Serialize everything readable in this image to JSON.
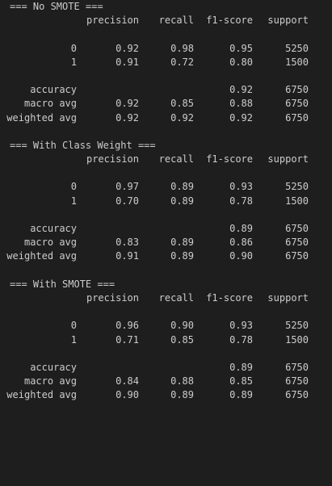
{
  "headers": {
    "precision": "precision",
    "recall": "recall",
    "f1": "f1-score",
    "support": "support"
  },
  "reports": [
    {
      "title": "=== No SMOTE ===",
      "classes": [
        {
          "label": "0",
          "precision": "0.92",
          "recall": "0.98",
          "f1": "0.95",
          "support": "5250"
        },
        {
          "label": "1",
          "precision": "0.91",
          "recall": "0.72",
          "f1": "0.80",
          "support": "1500"
        }
      ],
      "accuracy": {
        "label": "accuracy",
        "f1": "0.92",
        "support": "6750"
      },
      "macro": {
        "label": "macro avg",
        "precision": "0.92",
        "recall": "0.85",
        "f1": "0.88",
        "support": "6750"
      },
      "weighted": {
        "label": "weighted avg",
        "precision": "0.92",
        "recall": "0.92",
        "f1": "0.92",
        "support": "6750"
      }
    },
    {
      "title": "=== With Class Weight ===",
      "classes": [
        {
          "label": "0",
          "precision": "0.97",
          "recall": "0.89",
          "f1": "0.93",
          "support": "5250"
        },
        {
          "label": "1",
          "precision": "0.70",
          "recall": "0.89",
          "f1": "0.78",
          "support": "1500"
        }
      ],
      "accuracy": {
        "label": "accuracy",
        "f1": "0.89",
        "support": "6750"
      },
      "macro": {
        "label": "macro avg",
        "precision": "0.83",
        "recall": "0.89",
        "f1": "0.86",
        "support": "6750"
      },
      "weighted": {
        "label": "weighted avg",
        "precision": "0.91",
        "recall": "0.89",
        "f1": "0.90",
        "support": "6750"
      }
    },
    {
      "title": "=== With SMOTE ===",
      "classes": [
        {
          "label": "0",
          "precision": "0.96",
          "recall": "0.90",
          "f1": "0.93",
          "support": "5250"
        },
        {
          "label": "1",
          "precision": "0.71",
          "recall": "0.85",
          "f1": "0.78",
          "support": "1500"
        }
      ],
      "accuracy": {
        "label": "accuracy",
        "f1": "0.89",
        "support": "6750"
      },
      "macro": {
        "label": "macro avg",
        "precision": "0.84",
        "recall": "0.88",
        "f1": "0.85",
        "support": "6750"
      },
      "weighted": {
        "label": "weighted avg",
        "precision": "0.90",
        "recall": "0.89",
        "f1": "0.89",
        "support": "6750"
      }
    }
  ]
}
